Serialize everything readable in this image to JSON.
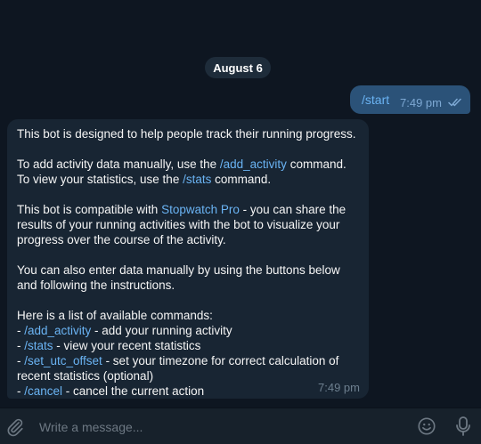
{
  "chat": {
    "date_label": "August 6",
    "outgoing": {
      "text": "/start",
      "time": "7:49 pm",
      "status_icon": "double-check-icon"
    },
    "incoming": {
      "p1": "This bot is designed to help people track their running progress.",
      "p2_a": "To add activity data manually, use the ",
      "p2_cmd1": "/add_activity",
      "p2_b": " command. To view your statistics, use the ",
      "p2_cmd2": "/stats",
      "p2_c": " command.",
      "p3_a": "This bot is compatible with ",
      "p3_link": "Stopwatch Pro",
      "p3_b": " - you can share the results of your running activities with the bot to visualize your progress over the course of the activity.",
      "p4": "You can also enter data manually by using the buttons below and following the instructions.",
      "p5_title": "Here is a list of available commands:",
      "commands": [
        {
          "prefix": "- ",
          "cmd": "/add_activity",
          "desc": " - add your running activity"
        },
        {
          "prefix": "- ",
          "cmd": "/stats",
          "desc": " - view your recent statistics"
        },
        {
          "prefix": "- ",
          "cmd": "/set_utc_offset",
          "desc": " - set your timezone for correct calculation of recent statistics (optional)"
        },
        {
          "prefix": "- ",
          "cmd": "/cancel",
          "desc": " - cancel the current action"
        }
      ],
      "time": "7:49 pm"
    }
  },
  "composer": {
    "placeholder": "Write a message...",
    "attach_icon": "paperclip-icon",
    "emoji_icon": "emoji-icon",
    "mic_icon": "microphone-icon"
  },
  "colors": {
    "background": "#0e1621",
    "incoming_bubble": "#182533",
    "outgoing_bubble": "#2b5278",
    "link": "#6ab3f3",
    "composer": "#17212b"
  }
}
